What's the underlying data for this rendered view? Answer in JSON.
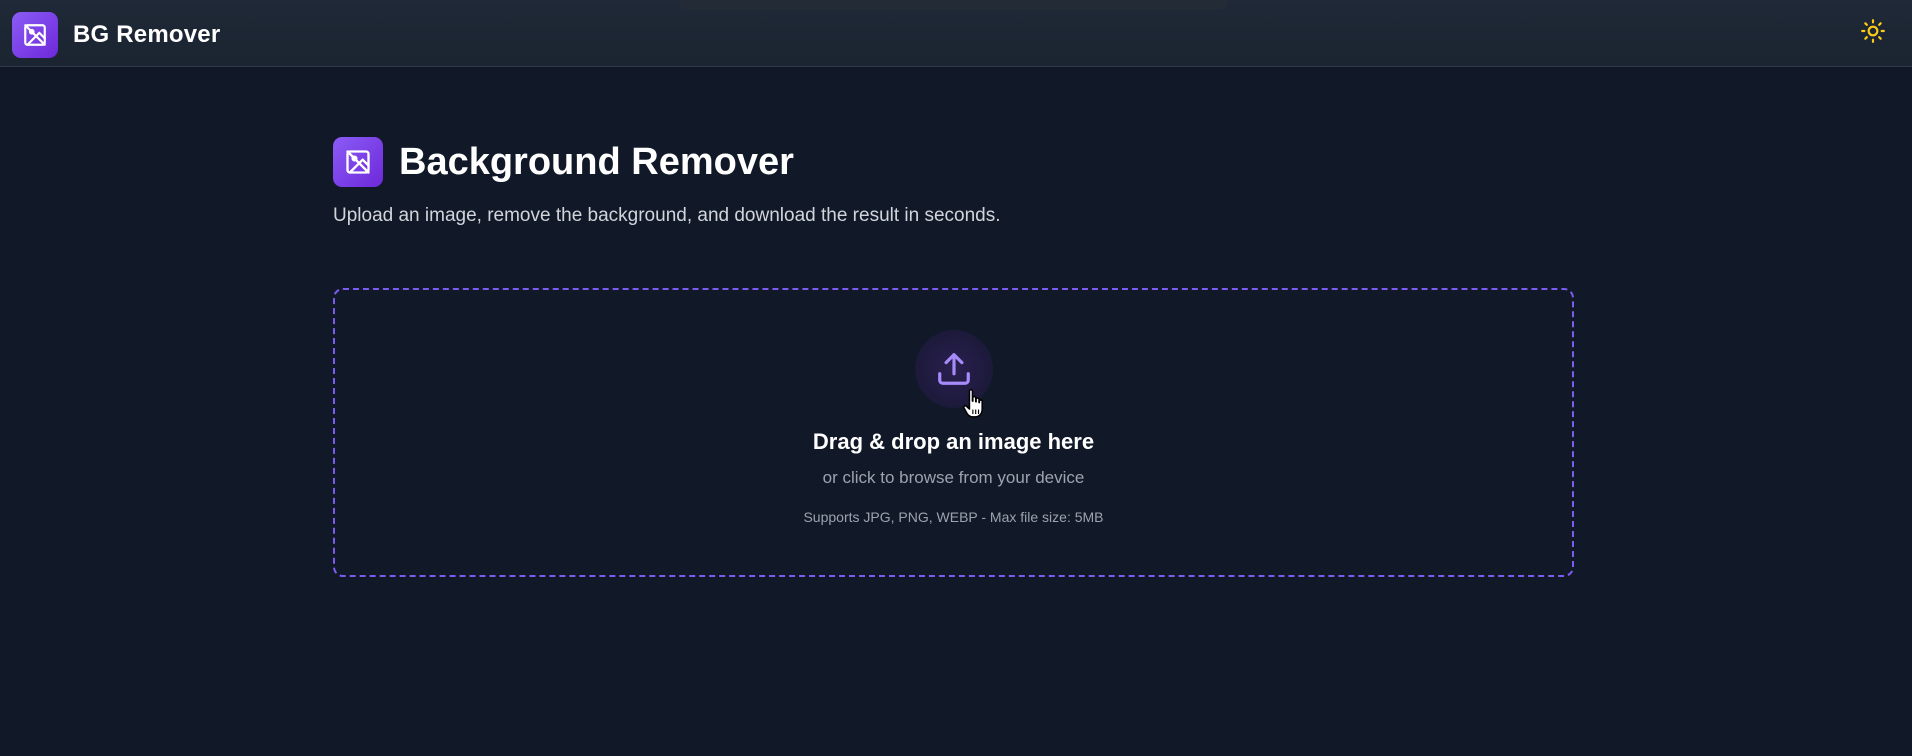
{
  "header": {
    "brand_name": "BG Remover",
    "logo_icon": "image-off-icon",
    "theme_icon": "sun-icon"
  },
  "main": {
    "title": "Background Remover",
    "subtitle": "Upload an image, remove the background, and download the result in seconds."
  },
  "dropzone": {
    "icon": "upload-icon",
    "title": "Drag & drop an image here",
    "subtitle": "or click to browse from your device",
    "note": "Supports JPG, PNG, WEBP - Max file size: 5MB"
  },
  "colors": {
    "background": "#111827",
    "header": "#1f2937",
    "accent": "#7c3aed",
    "dropzone_border": "#7c5cf0",
    "sun": "#facc15"
  }
}
